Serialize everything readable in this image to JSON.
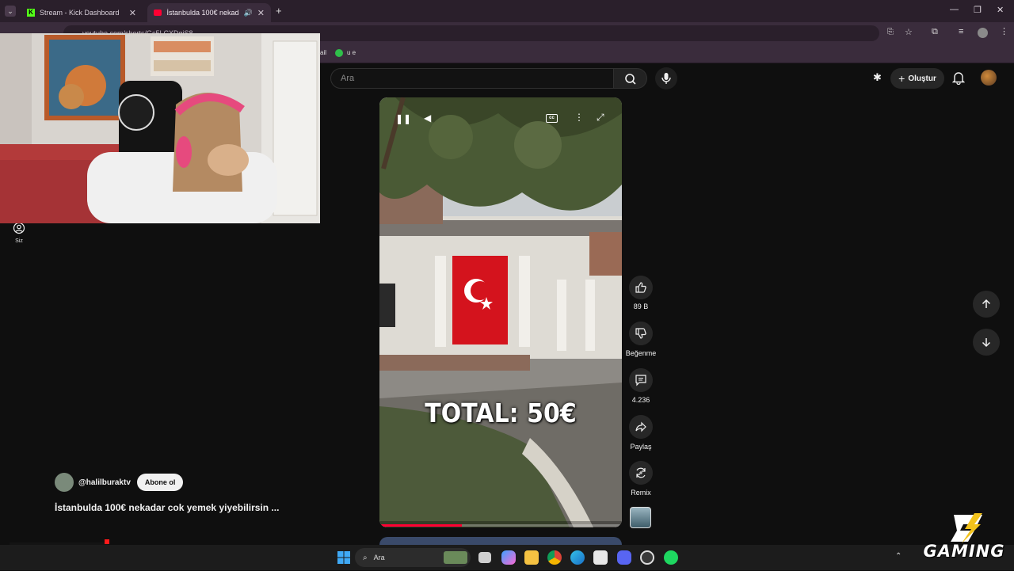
{
  "browser": {
    "tabs": [
      {
        "label": "Stream - Kick Dashboard",
        "active": false
      },
      {
        "label": "İstanbulda 100€ nekadar co",
        "active": true
      }
    ],
    "url": "youtube.com/shorts/Gc5LCXDqiS8",
    "bookmarks": [
      "ail",
      "u e"
    ]
  },
  "youtube": {
    "search_placeholder": "Ara",
    "create_label": "Oluştur",
    "sidebar_you_label": "Siz"
  },
  "short": {
    "overlay_text": "TOTAL: 50€",
    "channel": "@halilburaktv",
    "subscribe_label": "Abone ol",
    "title": "İstanbulda 100€ nekadar cok yemek yiyebilirsin ...",
    "progress_fraction": 0.34,
    "actions": {
      "likes": "89 B",
      "dislike_label": "Beğenme",
      "comments": "4.236",
      "share_label": "Paylaş",
      "remix_label": "Remix"
    }
  },
  "taskbar": {
    "search_placeholder": "Ara"
  },
  "watermark": {
    "text": "GAMING"
  },
  "colors": {
    "yt_bg": "#0f0f0f",
    "browser_frame": "#3a2c3c",
    "flag_red": "#d4131d",
    "progress_red": "#ff0033"
  }
}
